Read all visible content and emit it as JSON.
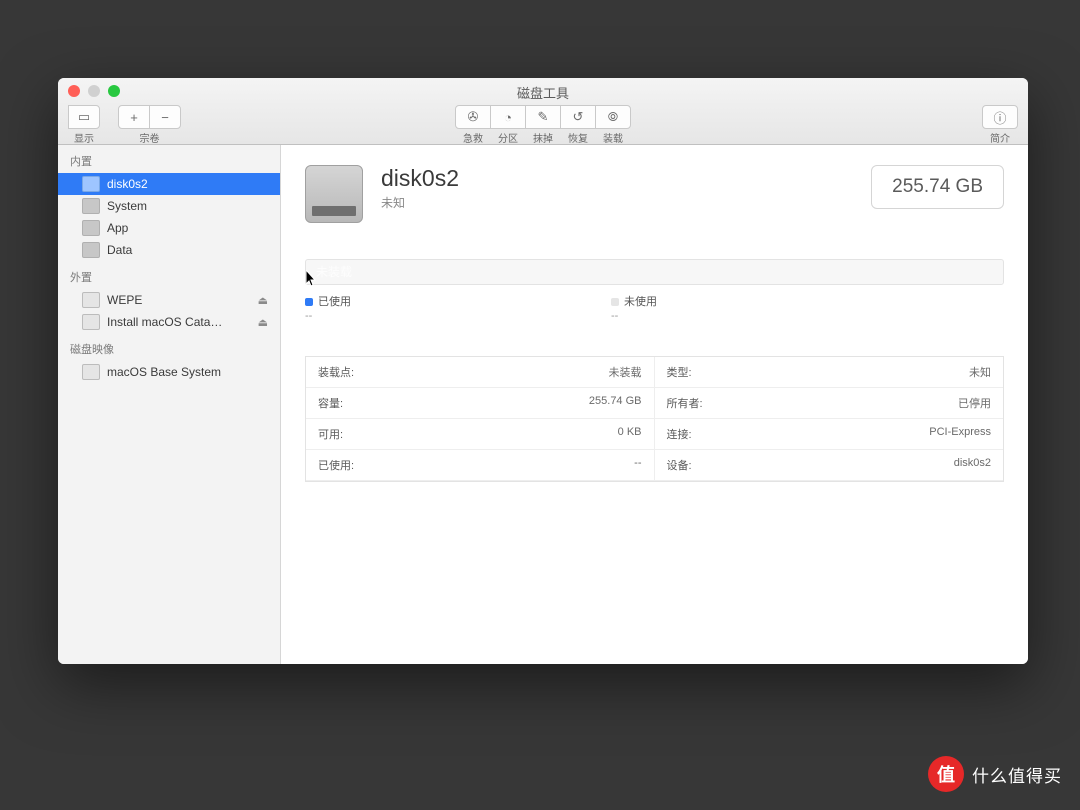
{
  "window": {
    "title": "磁盘工具"
  },
  "toolbar": {
    "left": [
      {
        "label": "显示",
        "seg": [
          "▭"
        ]
      },
      {
        "label": "宗卷",
        "seg": [
          "+",
          "−"
        ]
      }
    ],
    "center": [
      {
        "label": "急救",
        "icon": "✇"
      },
      {
        "label": "分区",
        "icon": "◔"
      },
      {
        "label": "抹掉",
        "icon": "✎"
      },
      {
        "label": "恢复",
        "icon": "↺"
      },
      {
        "label": "装载",
        "icon": "⦾"
      }
    ],
    "right": {
      "label": "简介",
      "icon": "ⓘ"
    }
  },
  "sidebar": {
    "sections": [
      {
        "title": "内置",
        "items": [
          {
            "label": "disk0s2",
            "selected": true,
            "type": "int"
          },
          {
            "label": "System",
            "type": "int"
          },
          {
            "label": "App",
            "type": "int"
          },
          {
            "label": "Data",
            "type": "int"
          }
        ]
      },
      {
        "title": "外置",
        "items": [
          {
            "label": "WEPE",
            "type": "ext",
            "eject": true
          },
          {
            "label": "Install macOS Cata…",
            "type": "ext",
            "eject": true
          }
        ]
      },
      {
        "title": "磁盘映像",
        "items": [
          {
            "label": "macOS Base System",
            "type": "ext"
          }
        ]
      }
    ]
  },
  "volume": {
    "name": "disk0s2",
    "subtitle": "未知",
    "size": "255.74 GB",
    "bar_label": "未装载",
    "legend": [
      {
        "color": "#2f7bf6",
        "label": "已使用",
        "value": "--"
      },
      {
        "color": "#e5e5e5",
        "label": "未使用",
        "value": "--"
      }
    ],
    "info": [
      {
        "k": "装载点:",
        "v": "未装载"
      },
      {
        "k": "类型:",
        "v": "未知"
      },
      {
        "k": "容量:",
        "v": "255.74 GB"
      },
      {
        "k": "所有者:",
        "v": "已停用"
      },
      {
        "k": "可用:",
        "v": "0 KB"
      },
      {
        "k": "连接:",
        "v": "PCI-Express"
      },
      {
        "k": "已使用:",
        "v": "--"
      },
      {
        "k": "设备:",
        "v": "disk0s2"
      }
    ]
  },
  "watermark": {
    "badge": "值",
    "text": "什么值得买"
  }
}
